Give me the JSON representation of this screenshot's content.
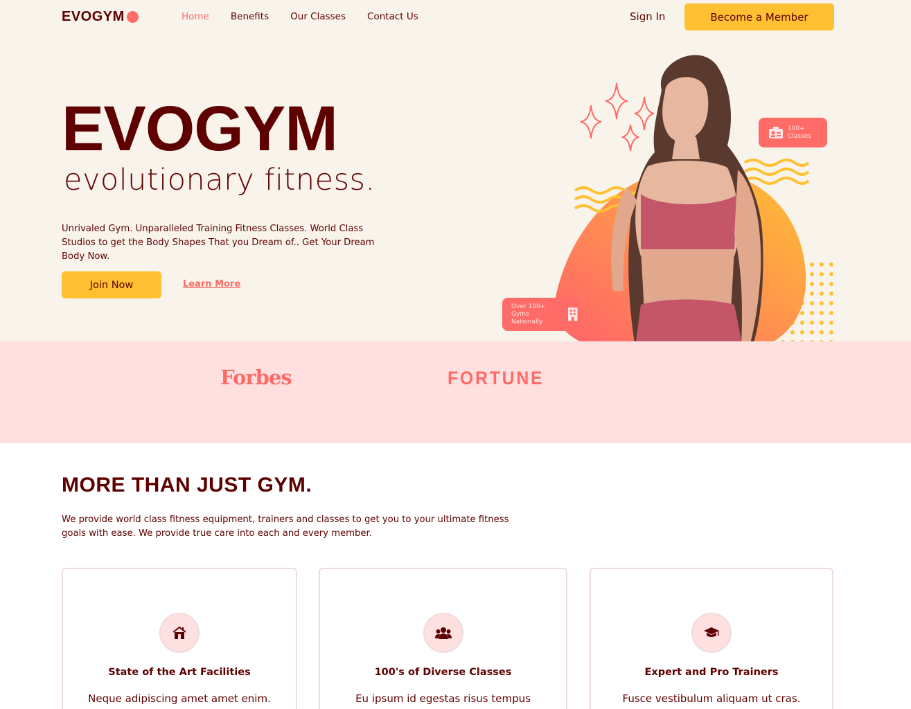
{
  "nav": {
    "logo": "EVOGYM",
    "links": [
      "Home",
      "Benefits",
      "Our Classes",
      "Contact Us"
    ],
    "sign_in": "Sign In",
    "cta": "Become a Member"
  },
  "hero": {
    "title": "EVOGYM",
    "subtitle": "evolutionary fitness.",
    "description": "Unrivaled Gym. Unparalleled Training Fitness Classes. World Class Studios to get the Body Shapes That you Dream of.. Get Your Dream Body Now.",
    "join_button": "Join Now",
    "learn_more": "Learn More",
    "badge_classes": [
      "100+",
      "Classes"
    ],
    "badge_gyms": [
      "Over 100+",
      "Gyms Nationally"
    ]
  },
  "sponsors": [
    "Forbes",
    "FORTUNE"
  ],
  "benefits": {
    "title": "MORE THAN JUST GYM.",
    "description": "We provide world class fitness equipment, trainers and classes to get you to your ultimate fitness goals with ease. We provide true care into each and every member.",
    "cards": [
      {
        "icon": "home-icon",
        "title": "State of the Art Facilities",
        "text": "Neque adipiscing amet amet enim. Feugiat dolor enim fermentum in a in lectus pellentesque."
      },
      {
        "icon": "users-icon",
        "title": "100's of Diverse Classes",
        "text": "Eu ipsum id egestas risus tempus enim semper felis quis. Nec consectetur ac venenatis facilisi est."
      },
      {
        "icon": "graduation-cap-icon",
        "title": "Expert and Pro Trainers",
        "text": "Fusce vestibulum aliquam ut cras. Nisl lectus egestas sapien nisl. Lacus at mi sit pellentesque."
      }
    ]
  },
  "colors": {
    "primary_text": "#5e0000",
    "accent": "#ff6b66",
    "yellow": "#ffc132",
    "hero_bg": "#f8f4eb",
    "sponsor_bg": "#ffe0e0"
  }
}
